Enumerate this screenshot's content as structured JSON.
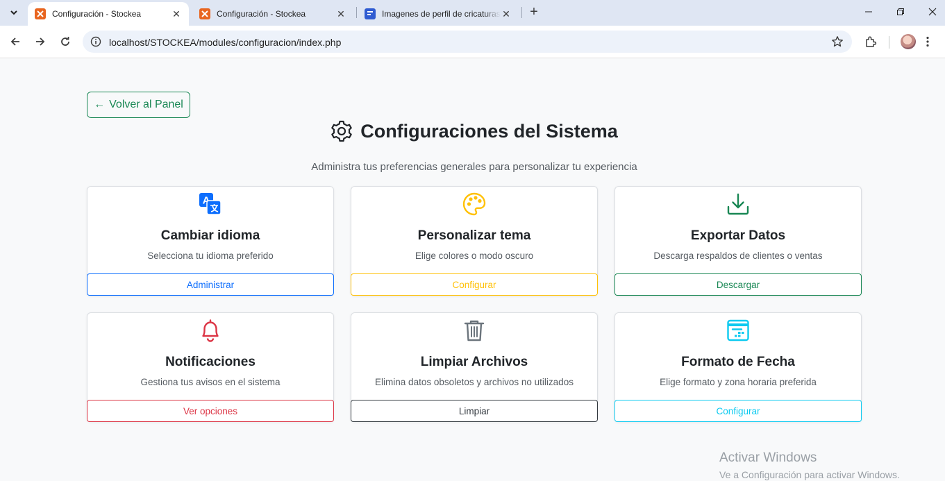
{
  "browser": {
    "tabs": [
      {
        "title": "Configuración - Stockea",
        "active": true
      },
      {
        "title": "Configuración - Stockea",
        "active": false
      },
      {
        "title": "Imagenes de perfil de cricaturas",
        "active": false
      }
    ],
    "url": "localhost/STOCKEA/modules/configuracion/index.php"
  },
  "page": {
    "back_button": "Volver al Panel",
    "back_arrow": "←",
    "title": "Configuraciones del Sistema",
    "subtitle": "Administra tus preferencias generales para personalizar tu experiencia"
  },
  "cards": [
    {
      "icon": "translate-icon",
      "title": "Cambiar idioma",
      "description": "Selecciona tu idioma preferido",
      "button": "Administrar",
      "color": "#0d6efd"
    },
    {
      "icon": "palette-icon",
      "title": "Personalizar tema",
      "description": "Elige colores o modo oscuro",
      "button": "Configurar",
      "color": "#ffc107"
    },
    {
      "icon": "download-icon",
      "title": "Exportar Datos",
      "description": "Descarga respaldos de clientes o ventas",
      "button": "Descargar",
      "color": "#198754"
    },
    {
      "icon": "bell-icon",
      "title": "Notificaciones",
      "description": "Gestiona tus avisos en el sistema",
      "button": "Ver opciones",
      "color": "#dc3545"
    },
    {
      "icon": "trash-icon",
      "title": "Limpiar Archivos",
      "description": "Elimina datos obsoletos y archivos no utilizados",
      "button": "Limpiar",
      "color": "#343a40"
    },
    {
      "icon": "calendar-icon",
      "title": "Formato de Fecha",
      "description": "Elige formato y zona horaria preferida",
      "button": "Configurar",
      "color": "#0dcaf0"
    }
  ],
  "watermark": {
    "line1": "Activar Windows",
    "line2": "Ve a Configuración para activar Windows."
  }
}
